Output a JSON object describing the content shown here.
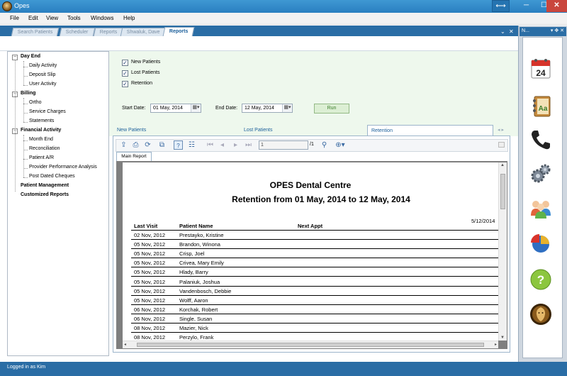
{
  "window": {
    "title": "Opes",
    "restore_glyph": "⟷",
    "min_glyph": "─",
    "max_glyph": "☐",
    "close_glyph": "✕"
  },
  "menu": [
    "File",
    "Edit",
    "View",
    "Tools",
    "Windows",
    "Help"
  ],
  "doc_tabs": [
    {
      "label": "Search Patients",
      "active": false
    },
    {
      "label": "Scheduler",
      "active": false
    },
    {
      "label": "Reports",
      "active": false
    },
    {
      "label": "Shwaluk, Dave",
      "active": false
    },
    {
      "label": "Reports",
      "active": true
    }
  ],
  "doc_tab_controls": {
    "pin": "⌄",
    "close": "✕"
  },
  "tree": [
    {
      "label": "Day End",
      "children": [
        "Daily Activity",
        "Deposit Slip",
        "User Activity"
      ]
    },
    {
      "label": "Billing",
      "children": [
        "Ortho",
        "Service Charges",
        "Statements"
      ]
    },
    {
      "label": "Financial Activity",
      "children": [
        "Month End",
        "Reconciliation",
        "Patient A/R",
        "Provider Performance Analysis",
        "Post Dated Cheques"
      ]
    },
    {
      "label": "Patient Management",
      "children": []
    },
    {
      "label": "Customized Reports",
      "children": []
    }
  ],
  "options": {
    "new_patients": {
      "label": "New Patients",
      "checked": true
    },
    "lost_patients": {
      "label": "Lost Patients",
      "checked": true
    },
    "retention": {
      "label": "Retention",
      "checked": true
    },
    "start_date_label": "Start Date:",
    "start_date": "01 May, 2014",
    "end_date_label": "End Date:",
    "end_date": "12 May, 2014",
    "run_label": "Run"
  },
  "report_tabs": [
    {
      "label": "New Patients",
      "active": false
    },
    {
      "label": "Lost Patients",
      "active": false
    },
    {
      "label": "Retention",
      "active": true
    }
  ],
  "report_tab_nav": "◂ ▸",
  "viewer": {
    "page_value": "1",
    "page_total": "/1",
    "main_tab": "Main Report"
  },
  "report": {
    "clinic": "OPES Dental Centre",
    "title": "Retention from  01 May, 2014 to 12 May, 2014",
    "print_date": "5/12/2014",
    "columns": [
      "Last Visit",
      "Patient Name",
      "Next Appt"
    ],
    "rows": [
      [
        "02 Nov, 2012",
        "Prestayko, Kristine"
      ],
      [
        "05 Nov, 2012",
        "Brandon, Winona"
      ],
      [
        "05 Nov, 2012",
        "Crisp, Joel"
      ],
      [
        "05 Nov, 2012",
        "Crivea, Mary Emily"
      ],
      [
        "05 Nov, 2012",
        "Hlady, Barry"
      ],
      [
        "05 Nov, 2012",
        "Palaniuk, Joshua"
      ],
      [
        "05 Nov, 2012",
        "Vandenbosch, Debbie"
      ],
      [
        "05 Nov, 2012",
        "Wolff, Aaron"
      ],
      [
        "06 Nov, 2012",
        "Korchak, Robert"
      ],
      [
        "06 Nov, 2012",
        "Single, Susan"
      ],
      [
        "08 Nov, 2012",
        "Mazier, Nick"
      ],
      [
        "08 Nov, 2012",
        "Perzylo, Frank"
      ]
    ]
  },
  "right_panel": {
    "title": "N...",
    "controls": "▾ ✥ ✕",
    "icons": [
      "calendar-icon",
      "address-book-icon",
      "phone-icon",
      "gears-icon",
      "users-icon",
      "pie-chart-icon",
      "help-icon",
      "lion-logo-icon"
    ],
    "calendar_day": "24",
    "address_letters": "Aa",
    "help_glyph": "?"
  },
  "status": {
    "text": "Logged in as Kim"
  }
}
